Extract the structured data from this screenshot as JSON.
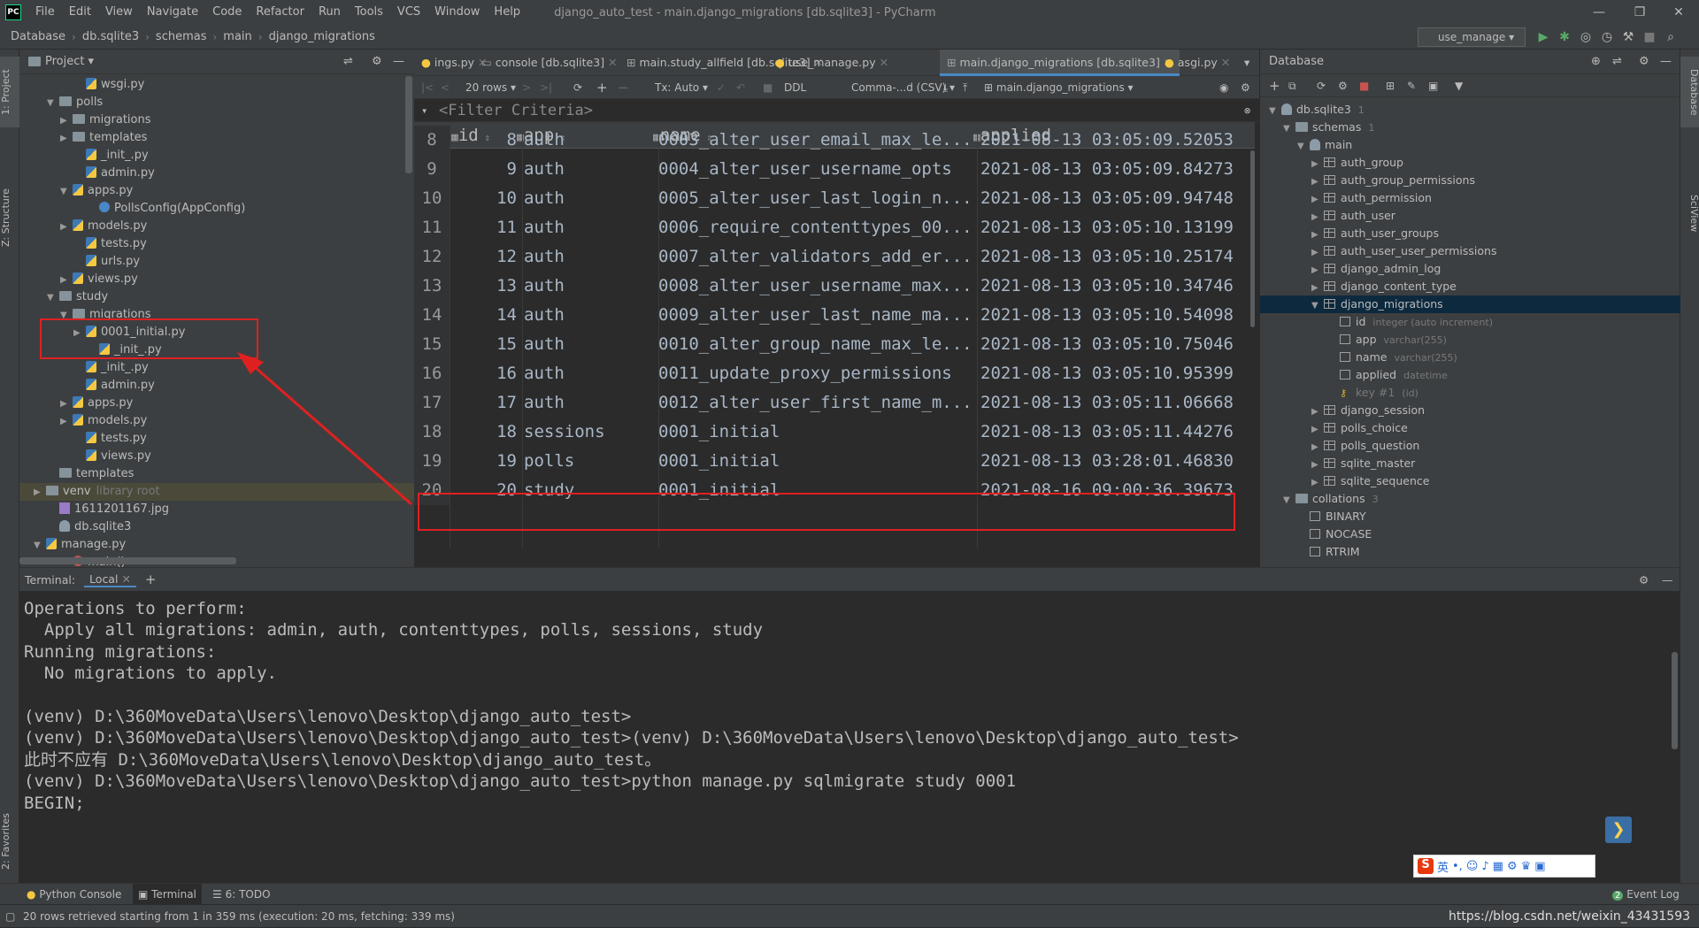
{
  "app": {
    "title": "django_auto_test - main.django_migrations [db.sqlite3] - PyCharm",
    "logo": "PC"
  },
  "menu": [
    "File",
    "Edit",
    "View",
    "Navigate",
    "Code",
    "Refactor",
    "Run",
    "Tools",
    "VCS",
    "Window",
    "Help"
  ],
  "breadcrumb": [
    "Database",
    "db.sqlite3",
    "schemas",
    "main",
    "django_migrations"
  ],
  "run_config": "use_manage",
  "project_panel": {
    "title": "Project",
    "tree": [
      {
        "label": "wsgi.py",
        "icon": "python-file-icon",
        "indent": 3,
        "arrow": ""
      },
      {
        "label": "polls",
        "icon": "folder-icon",
        "indent": 1,
        "arrow": "down"
      },
      {
        "label": "migrations",
        "icon": "folder-icon",
        "indent": 2,
        "arrow": "right"
      },
      {
        "label": "templates",
        "icon": "folder-icon",
        "indent": 2,
        "arrow": "right"
      },
      {
        "label": "_init_.py",
        "icon": "python-file-icon",
        "indent": 3,
        "arrow": ""
      },
      {
        "label": "admin.py",
        "icon": "python-file-icon",
        "indent": 3,
        "arrow": ""
      },
      {
        "label": "apps.py",
        "icon": "python-file-icon",
        "indent": 2,
        "arrow": "down"
      },
      {
        "label": "PollsConfig(AppConfig)",
        "icon": "class-icon",
        "indent": 4,
        "arrow": ""
      },
      {
        "label": "models.py",
        "icon": "python-file-icon",
        "indent": 2,
        "arrow": "right"
      },
      {
        "label": "tests.py",
        "icon": "python-file-icon",
        "indent": 3,
        "arrow": ""
      },
      {
        "label": "urls.py",
        "icon": "python-file-icon",
        "indent": 3,
        "arrow": ""
      },
      {
        "label": "views.py",
        "icon": "python-file-icon",
        "indent": 2,
        "arrow": "right"
      },
      {
        "label": "study",
        "icon": "folder-icon",
        "indent": 1,
        "arrow": "down"
      },
      {
        "label": "migrations",
        "icon": "folder-icon",
        "indent": 2,
        "arrow": "down"
      },
      {
        "label": "0001_initial.py",
        "icon": "python-file-icon",
        "indent": 3,
        "arrow": "right"
      },
      {
        "label": "_init_.py",
        "icon": "python-file-icon",
        "indent": 4,
        "arrow": ""
      },
      {
        "label": "_init_.py",
        "icon": "python-file-icon",
        "indent": 3,
        "arrow": ""
      },
      {
        "label": "admin.py",
        "icon": "python-file-icon",
        "indent": 3,
        "arrow": ""
      },
      {
        "label": "apps.py",
        "icon": "python-file-icon",
        "indent": 2,
        "arrow": "right"
      },
      {
        "label": "models.py",
        "icon": "python-file-icon",
        "indent": 2,
        "arrow": "right"
      },
      {
        "label": "tests.py",
        "icon": "python-file-icon",
        "indent": 3,
        "arrow": ""
      },
      {
        "label": "views.py",
        "icon": "python-file-icon",
        "indent": 3,
        "arrow": ""
      },
      {
        "label": "templates",
        "icon": "folder-icon",
        "indent": 1,
        "arrow": ""
      },
      {
        "label": "venv",
        "icon": "folder-icon",
        "indent": 0,
        "arrow": "right",
        "suffix": "library root"
      },
      {
        "label": "1611201167.jpg",
        "icon": "image-file-icon",
        "indent": 1,
        "arrow": ""
      },
      {
        "label": "db.sqlite3",
        "icon": "database-file-icon",
        "indent": 1,
        "arrow": ""
      },
      {
        "label": "manage.py",
        "icon": "python-file-icon",
        "indent": 0,
        "arrow": "down"
      },
      {
        "label": "main()",
        "icon": "method-icon",
        "indent": 2,
        "arrow": ""
      }
    ]
  },
  "tabs": [
    {
      "label": "ings.py",
      "active": false
    },
    {
      "label": "console [db.sqlite3]",
      "active": false
    },
    {
      "label": "main.study_allfield [db.sqlite3]",
      "active": false
    },
    {
      "label": "use_manage.py",
      "active": false
    },
    {
      "label": "main.django_migrations [db.sqlite3]",
      "active": true
    },
    {
      "label": "asgi.py",
      "active": false
    }
  ],
  "grid_toolbar": {
    "rows": "20 rows",
    "tx": "Tx: Auto",
    "ddl": "DDL",
    "format": "Comma-...d (CSV)",
    "table": "main.django_migrations"
  },
  "filter_placeholder": "<Filter Criteria>",
  "grid": {
    "columns": [
      "id",
      "app",
      "name",
      "applied"
    ],
    "rows": [
      {
        "n": "8",
        "id": "8",
        "app": "auth",
        "name": "0003_alter_user_email_max_le...",
        "applied": "2021-08-13 03:05:09.52053"
      },
      {
        "n": "9",
        "id": "9",
        "app": "auth",
        "name": "0004_alter_user_username_opts",
        "applied": "2021-08-13 03:05:09.84273"
      },
      {
        "n": "10",
        "id": "10",
        "app": "auth",
        "name": "0005_alter_user_last_login_n...",
        "applied": "2021-08-13 03:05:09.94748"
      },
      {
        "n": "11",
        "id": "11",
        "app": "auth",
        "name": "0006_require_contenttypes_00...",
        "applied": "2021-08-13 03:05:10.13199"
      },
      {
        "n": "12",
        "id": "12",
        "app": "auth",
        "name": "0007_alter_validators_add_er...",
        "applied": "2021-08-13 03:05:10.25174"
      },
      {
        "n": "13",
        "id": "13",
        "app": "auth",
        "name": "0008_alter_user_username_max...",
        "applied": "2021-08-13 03:05:10.34746"
      },
      {
        "n": "14",
        "id": "14",
        "app": "auth",
        "name": "0009_alter_user_last_name_ma...",
        "applied": "2021-08-13 03:05:10.54098"
      },
      {
        "n": "15",
        "id": "15",
        "app": "auth",
        "name": "0010_alter_group_name_max_le...",
        "applied": "2021-08-13 03:05:10.75046"
      },
      {
        "n": "16",
        "id": "16",
        "app": "auth",
        "name": "0011_update_proxy_permissions",
        "applied": "2021-08-13 03:05:10.95399"
      },
      {
        "n": "17",
        "id": "17",
        "app": "auth",
        "name": "0012_alter_user_first_name_m...",
        "applied": "2021-08-13 03:05:11.06668"
      },
      {
        "n": "18",
        "id": "18",
        "app": "sessions",
        "name": "0001_initial",
        "applied": "2021-08-13 03:05:11.44276"
      },
      {
        "n": "19",
        "id": "19",
        "app": "polls",
        "name": "0001_initial",
        "applied": "2021-08-13 03:28:01.46830"
      },
      {
        "n": "20",
        "id": "20",
        "app": "study",
        "name": "0001_initial",
        "applied": "2021-08-16 09:00:36.39673"
      }
    ]
  },
  "database_panel": {
    "title": "Database",
    "db": "db.sqlite3",
    "db_count": "1",
    "schemas": "schemas",
    "schemas_count": "1",
    "main": "main",
    "tables": [
      "auth_group",
      "auth_group_permissions",
      "auth_permission",
      "auth_user",
      "auth_user_groups",
      "auth_user_user_permissions",
      "django_admin_log",
      "django_content_type",
      "django_migrations"
    ],
    "columns": [
      {
        "name": "id",
        "type": "integer (auto increment)"
      },
      {
        "name": "app",
        "type": "varchar(255)"
      },
      {
        "name": "name",
        "type": "varchar(255)"
      },
      {
        "name": "applied",
        "type": "datetime"
      }
    ],
    "key": {
      "name": "key #1",
      "type": "(id)"
    },
    "tables2": [
      "django_session",
      "polls_choice",
      "polls_question",
      "sqlite_master",
      "sqlite_sequence"
    ],
    "collations": "collations",
    "collations_count": "3",
    "collation_items": [
      "BINARY",
      "NOCASE",
      "RTRIM"
    ]
  },
  "terminal": {
    "label": "Terminal:",
    "tab": "Local",
    "lines": [
      "Operations to perform:",
      "  Apply all migrations: admin, auth, contenttypes, polls, sessions, study",
      "Running migrations:",
      "  No migrations to apply.",
      "",
      "(venv) D:\\360MoveData\\Users\\lenovo\\Desktop\\django_auto_test>",
      "(venv) D:\\360MoveData\\Users\\lenovo\\Desktop\\django_auto_test>(venv) D:\\360MoveData\\Users\\lenovo\\Desktop\\django_auto_test>",
      "此时不应有 D:\\360MoveData\\Users\\lenovo\\Desktop\\django_auto_test。",
      "(venv) D:\\360MoveData\\Users\\lenovo\\Desktop\\django_auto_test>python manage.py sqlmigrate study 0001",
      "BEGIN;"
    ]
  },
  "bottom_tabs": {
    "python_console": "Python Console",
    "terminal": "Terminal",
    "todo": "6: TODO",
    "event_log": "Event Log",
    "event_count": "2"
  },
  "side_tabs": {
    "project": "1: Project",
    "structure": "Z: Structure",
    "favorites": "2: Favorites",
    "database": "Database",
    "sciview": "SciView"
  },
  "status": {
    "message": "20 rows retrieved starting from 1 in 359 ms (execution: 20 ms, fetching: 339 ms)",
    "watermark": "https://blog.csdn.net/weixin_43431593"
  },
  "ime": {
    "lang": "英"
  },
  "colors": {
    "accent": "#4a88c7",
    "highlight": "#e02020",
    "bg": "#2b2b2b",
    "panel": "#3c3f41"
  }
}
